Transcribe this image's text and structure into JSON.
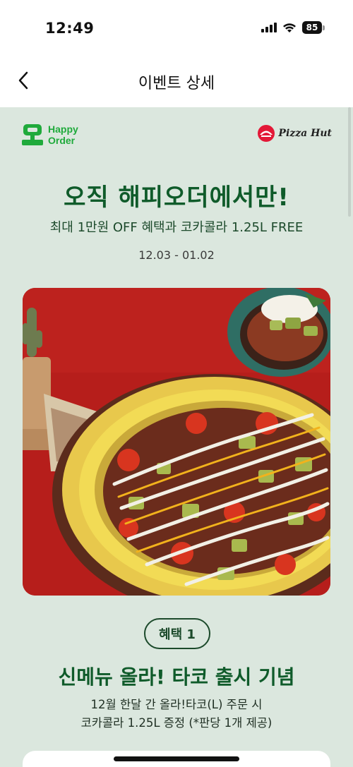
{
  "status_bar": {
    "time": "12:49",
    "battery": "85"
  },
  "nav": {
    "title": "이벤트 상세"
  },
  "event": {
    "partner_logo": {
      "line1": "Happy",
      "line2": "Order"
    },
    "brand_logo": {
      "text": "Pizza Hut"
    },
    "headline": "오직 해피오더에서만!",
    "subheadline": "최대 1만원 OFF 혜택과 코카콜라 1.25L FREE",
    "date_range": "12.03 - 01.02",
    "benefit": {
      "badge": "혜택 1",
      "title": "신메뉴 올라! 타코 출시 기념",
      "desc_line1": "12월 한달 간 올라!타코(L) 주문 시",
      "desc_line2": "코카콜라 1.25L 증정 (*판당 1개 제공)"
    }
  },
  "colors": {
    "accent_green": "#0f5b2a",
    "brand_green": "#1faa3b",
    "background": "#dbe7de",
    "hero_red": "#b51f1c"
  }
}
